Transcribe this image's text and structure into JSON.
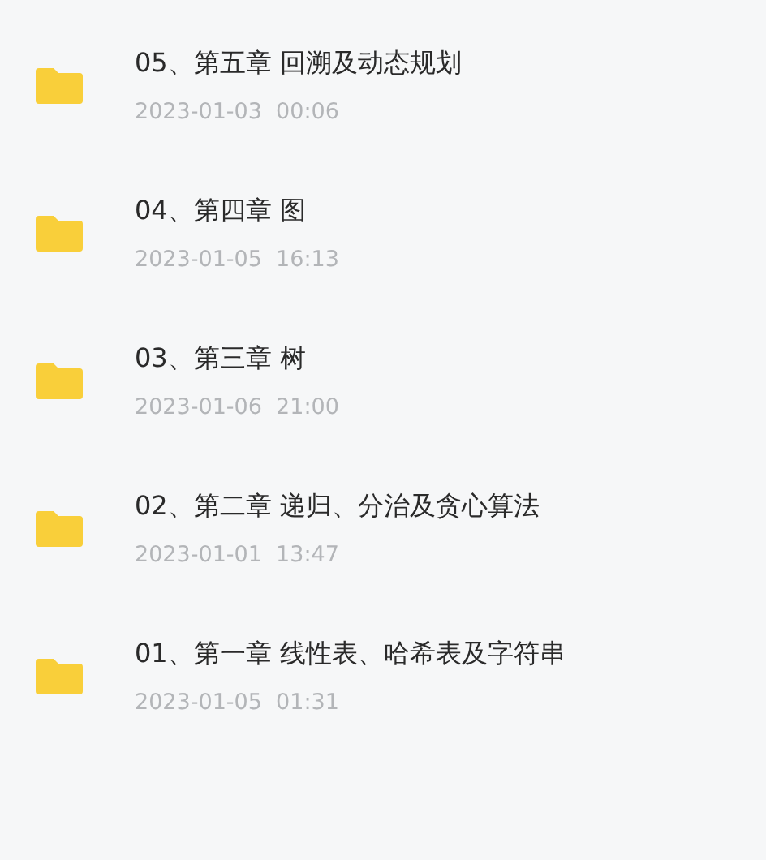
{
  "folders": [
    {
      "name": "05、第五章 回溯及动态规划",
      "date": "2023-01-03  00:06"
    },
    {
      "name": "04、第四章 图",
      "date": "2023-01-05  16:13"
    },
    {
      "name": "03、第三章 树",
      "date": "2023-01-06  21:00"
    },
    {
      "name": "02、第二章 递归、分治及贪心算法",
      "date": "2023-01-01  13:47"
    },
    {
      "name": "01、第一章 线性表、哈希表及字符串",
      "date": "2023-01-05  01:31"
    }
  ]
}
